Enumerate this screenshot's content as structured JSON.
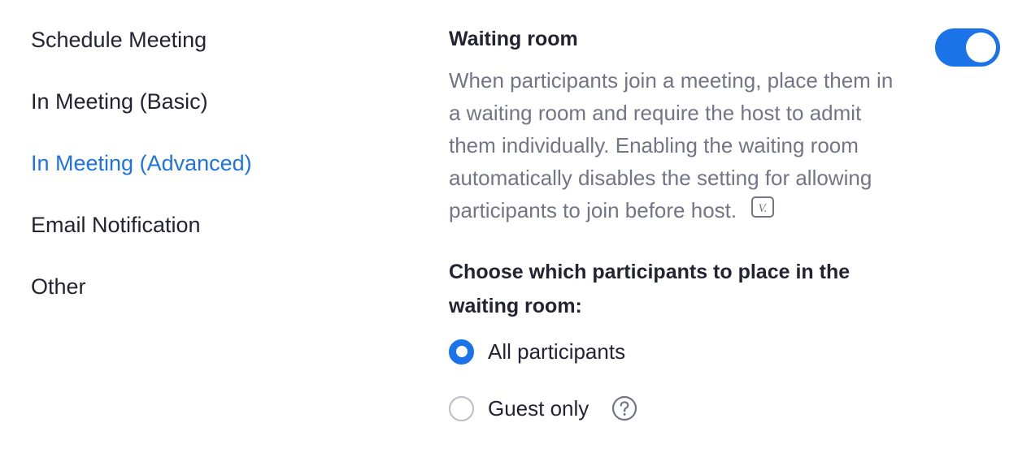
{
  "sidebar": {
    "items": [
      {
        "label": "Schedule Meeting",
        "active": false
      },
      {
        "label": "In Meeting (Basic)",
        "active": false
      },
      {
        "label": "In Meeting (Advanced)",
        "active": true
      },
      {
        "label": "Email Notification",
        "active": false
      },
      {
        "label": "Other",
        "active": false
      }
    ]
  },
  "setting": {
    "title": "Waiting room",
    "enabled": true,
    "description": "When participants join a meeting, place them in a waiting room and require the host to admit them individually. Enabling the waiting room automatically disables the setting for allowing participants to join before host.",
    "version_icon": "v-badge-icon",
    "version_text": "V.",
    "choose_label": "Choose which participants to place in the waiting room:",
    "options": [
      {
        "label": "All participants",
        "selected": true
      },
      {
        "label": "Guest only",
        "selected": false,
        "help_icon": "question-circle-icon"
      }
    ]
  },
  "colors": {
    "accent": "#1a73e8",
    "text": "#232333",
    "muted": "#747487"
  }
}
